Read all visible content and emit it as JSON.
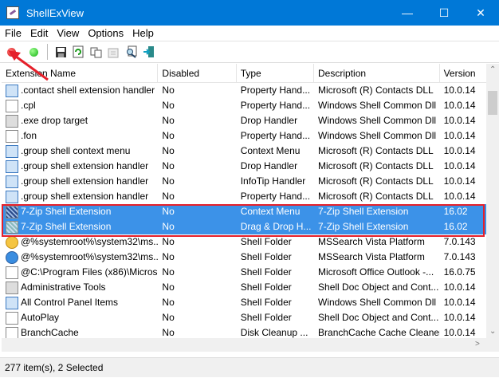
{
  "window": {
    "title": "ShellExView"
  },
  "menu": [
    "File",
    "Edit",
    "View",
    "Options",
    "Help"
  ],
  "toolbar": {
    "icons": [
      "disable-icon",
      "enable-icon",
      "save-icon",
      "refresh-icon",
      "copy-icon",
      "properties-icon",
      "find-icon",
      "exit-icon"
    ]
  },
  "columns": [
    "Extension Name",
    "Disabled",
    "Type",
    "Description",
    "Version"
  ],
  "rows": [
    {
      "name": ".contact shell extension handler",
      "disabled": "No",
      "type": "Property Hand...",
      "description": "Microsoft (R) Contacts DLL",
      "version": "10.0.14",
      "icon": "blue"
    },
    {
      "name": ".cpl",
      "disabled": "No",
      "type": "Property Hand...",
      "description": "Windows Shell Common Dll",
      "version": "10.0.14",
      "icon": "plain"
    },
    {
      "name": ".exe drop target",
      "disabled": "No",
      "type": "Drop Handler",
      "description": "Windows Shell Common Dll",
      "version": "10.0.14",
      "icon": "gray"
    },
    {
      "name": ".fon",
      "disabled": "No",
      "type": "Property Hand...",
      "description": "Windows Shell Common Dll",
      "version": "10.0.14",
      "icon": "plain"
    },
    {
      "name": ".group shell context menu",
      "disabled": "No",
      "type": "Context Menu",
      "description": "Microsoft (R) Contacts DLL",
      "version": "10.0.14",
      "icon": "blue"
    },
    {
      "name": ".group shell extension handler",
      "disabled": "No",
      "type": "Drop Handler",
      "description": "Microsoft (R) Contacts DLL",
      "version": "10.0.14",
      "icon": "blue"
    },
    {
      "name": ".group shell extension handler",
      "disabled": "No",
      "type": "InfoTip Handler",
      "description": "Microsoft (R) Contacts DLL",
      "version": "10.0.14",
      "icon": "blue"
    },
    {
      "name": ".group shell extension handler",
      "disabled": "No",
      "type": "Property Hand...",
      "description": "Microsoft (R) Contacts DLL",
      "version": "10.0.14",
      "icon": "blue"
    },
    {
      "name": "7-Zip Shell Extension",
      "disabled": "No",
      "type": "Context Menu",
      "description": "7-Zip Shell Extension",
      "version": "16.02",
      "icon": "zip",
      "selected": true
    },
    {
      "name": "7-Zip Shell Extension",
      "disabled": "No",
      "type": "Drag & Drop H...",
      "description": "7-Zip Shell Extension",
      "version": "16.02",
      "icon": "zip2",
      "selected": true
    },
    {
      "name": "@%systemroot%\\system32\\ms...",
      "disabled": "No",
      "type": "Shell Folder",
      "description": "MSSearch Vista Platform",
      "version": "7.0.143",
      "icon": "yellow"
    },
    {
      "name": "@%systemroot%\\system32\\ms...",
      "disabled": "No",
      "type": "Shell Folder",
      "description": "MSSearch Vista Platform",
      "version": "7.0.143",
      "icon": "globe"
    },
    {
      "name": "@C:\\Program Files (x86)\\Micros...",
      "disabled": "No",
      "type": "Shell Folder",
      "description": "Microsoft Office Outlook -...",
      "version": "16.0.75",
      "icon": "plain"
    },
    {
      "name": "Administrative Tools",
      "disabled": "No",
      "type": "Shell Folder",
      "description": "Shell Doc Object and Cont...",
      "version": "10.0.14",
      "icon": "gray"
    },
    {
      "name": "All Control Panel Items",
      "disabled": "No",
      "type": "Shell Folder",
      "description": "Windows Shell Common Dll",
      "version": "10.0.14",
      "icon": "blue"
    },
    {
      "name": "AutoPlay",
      "disabled": "No",
      "type": "Shell Folder",
      "description": "Shell Doc Object and Cont...",
      "version": "10.0.14",
      "icon": "plain"
    },
    {
      "name": "BranchCache",
      "disabled": "No",
      "type": "Disk Cleanup ...",
      "description": "BranchCache Cache Cleaner",
      "version": "10.0.14",
      "icon": "plain"
    }
  ],
  "status": "277 item(s), 2 Selected",
  "colors": {
    "titlebar": "#0078d7",
    "selection": "#3c92e8",
    "highlight_box": "#e5202a"
  }
}
